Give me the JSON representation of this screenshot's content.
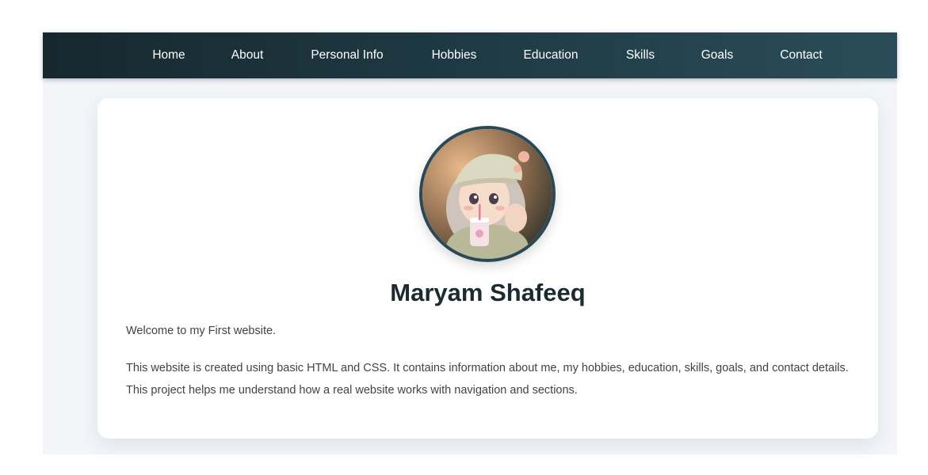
{
  "nav": {
    "items": [
      {
        "label": "Home"
      },
      {
        "label": "About"
      },
      {
        "label": "Personal Info"
      },
      {
        "label": "Hobbies"
      },
      {
        "label": "Education"
      },
      {
        "label": "Skills"
      },
      {
        "label": "Goals"
      },
      {
        "label": "Contact"
      }
    ]
  },
  "profile": {
    "avatar_icon": "profile-photo-icon",
    "name": "Maryam Shafeeq",
    "welcome": "Welcome to my First website.",
    "description": "This website is created using basic HTML and CSS. It contains information about me, my hobbies, education, skills, goals, and contact details. This project helps me understand how a real website works with navigation and sections."
  },
  "colors": {
    "nav_start": "#16282e",
    "nav_end": "#2a4d59",
    "avatar_border": "#2a4954",
    "heading": "#1c2b30",
    "body_text": "#3d4448"
  }
}
